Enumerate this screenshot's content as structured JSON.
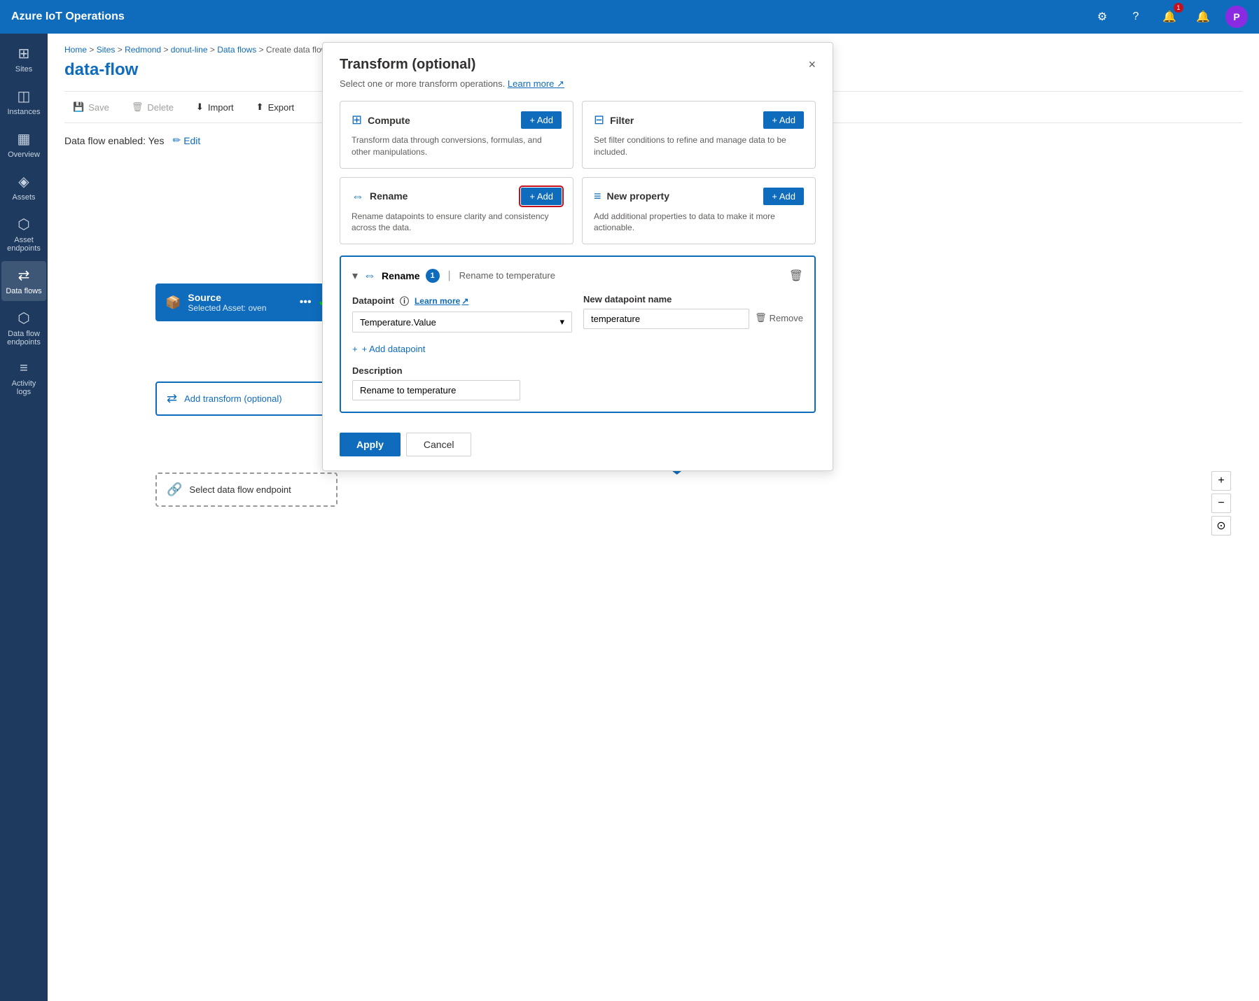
{
  "app": {
    "title": "Azure IoT Operations"
  },
  "nav_icons": {
    "settings": "⚙",
    "help": "?",
    "notification_count": "1",
    "bell": "🔔",
    "alert": "🔔",
    "avatar_label": "P"
  },
  "sidebar": {
    "items": [
      {
        "id": "sites",
        "label": "Sites",
        "icon": "⊞",
        "active": false
      },
      {
        "id": "instances",
        "label": "Instances",
        "icon": "◫",
        "active": false
      },
      {
        "id": "overview",
        "label": "Overview",
        "icon": "▦",
        "active": false
      },
      {
        "id": "assets",
        "label": "Assets",
        "icon": "◈",
        "active": false
      },
      {
        "id": "asset-endpoints",
        "label": "Asset endpoints",
        "icon": "⬡",
        "active": false
      },
      {
        "id": "data-flows",
        "label": "Data flows",
        "icon": "⇄",
        "active": true
      },
      {
        "id": "data-flow-endpoints",
        "label": "Data flow endpoints",
        "icon": "⬡",
        "active": false
      },
      {
        "id": "activity-logs",
        "label": "Activity logs",
        "icon": "≡",
        "active": false
      }
    ]
  },
  "breadcrumb": {
    "parts": [
      "Home",
      "Sites",
      "Redmond",
      "donut-line",
      "Data flows",
      "Create data flow"
    ]
  },
  "page_title": "data-flow",
  "toolbar": {
    "save_label": "Save",
    "delete_label": "Delete",
    "import_label": "Import",
    "export_label": "Export"
  },
  "data_flow_status": {
    "label": "Data flow enabled: Yes",
    "edit_label": "Edit"
  },
  "flow_nodes": {
    "source": {
      "title": "Source",
      "subtitle": "Selected Asset: oven",
      "menu_icon": "•••"
    },
    "transform": {
      "label": "Add transform (optional)"
    },
    "endpoint": {
      "label": "Select data flow endpoint"
    }
  },
  "transform_panel": {
    "title": "Transform (optional)",
    "subtitle": "Select one or more transform operations.",
    "learn_more_label": "Learn more",
    "close_label": "×",
    "operations": [
      {
        "id": "compute",
        "icon": "⊞",
        "title": "Compute",
        "description": "Transform data through conversions, formulas, and other manipulations.",
        "add_label": "+ Add"
      },
      {
        "id": "filter",
        "icon": "⊟",
        "title": "Filter",
        "description": "Set filter conditions to refine and manage data to be included.",
        "add_label": "+ Add"
      },
      {
        "id": "rename",
        "icon": "⇔",
        "title": "Rename",
        "description": "Rename datapoints to ensure clarity and consistency across the data.",
        "add_label": "+ Add",
        "highlighted": true
      },
      {
        "id": "new-property",
        "icon": "≡",
        "title": "New property",
        "description": "Add additional properties to data to make it more actionable.",
        "add_label": "+ Add"
      }
    ],
    "rename_section": {
      "title": "Rename",
      "badge": "1",
      "separator": "|",
      "subtitle": "Rename to temperature",
      "datapoint_label": "Datapoint",
      "learn_more_label": "Learn more",
      "datapoint_value": "Temperature.Value",
      "new_name_label": "New datapoint name",
      "new_name_value": "temperature",
      "remove_label": "Remove",
      "add_datapoint_label": "+ Add datapoint",
      "description_label": "Description",
      "description_value": "Rename to temperature"
    },
    "footer": {
      "apply_label": "Apply",
      "cancel_label": "Cancel"
    }
  },
  "zoom_controls": {
    "plus_label": "+",
    "minus_label": "−",
    "reset_label": "⊙"
  }
}
